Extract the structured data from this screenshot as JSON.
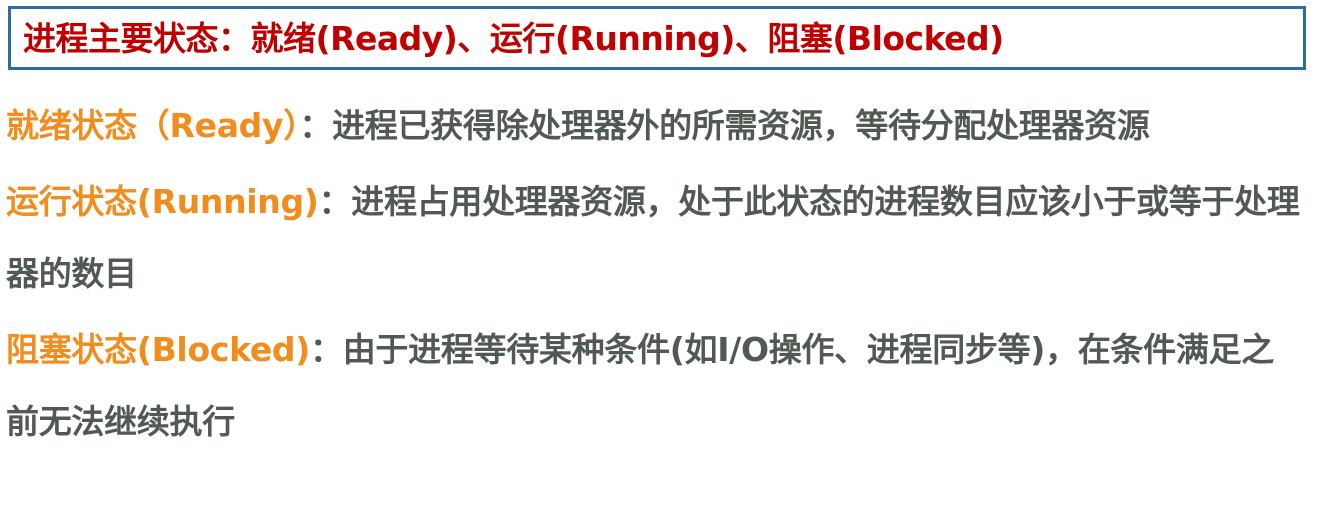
{
  "title": "进程主要状态：就绪(Ready)、运行(Running)、阻塞(Blocked)",
  "items": [
    {
      "term": "就绪状态（Ready）",
      "separator": "：",
      "description": "进程已获得除处理器外的所需资源，等待分配处理器资源"
    },
    {
      "term": "运行状态(Running)",
      "separator": "：",
      "description": "进程占用处理器资源，处于此状态的进程数目应该小于或等于处理器的数目"
    },
    {
      "term": "阻塞状态(Blocked)",
      "separator": "：",
      "description": "由于进程等待某种条件(如I/O操作、进程同步等)，在条件满足之前无法继续执行"
    }
  ],
  "colors": {
    "title_text": "#c00000",
    "title_border": "#2e6da4",
    "term_text": "#f28c1c",
    "body_text": "#505a52",
    "background": "#ffffff"
  }
}
